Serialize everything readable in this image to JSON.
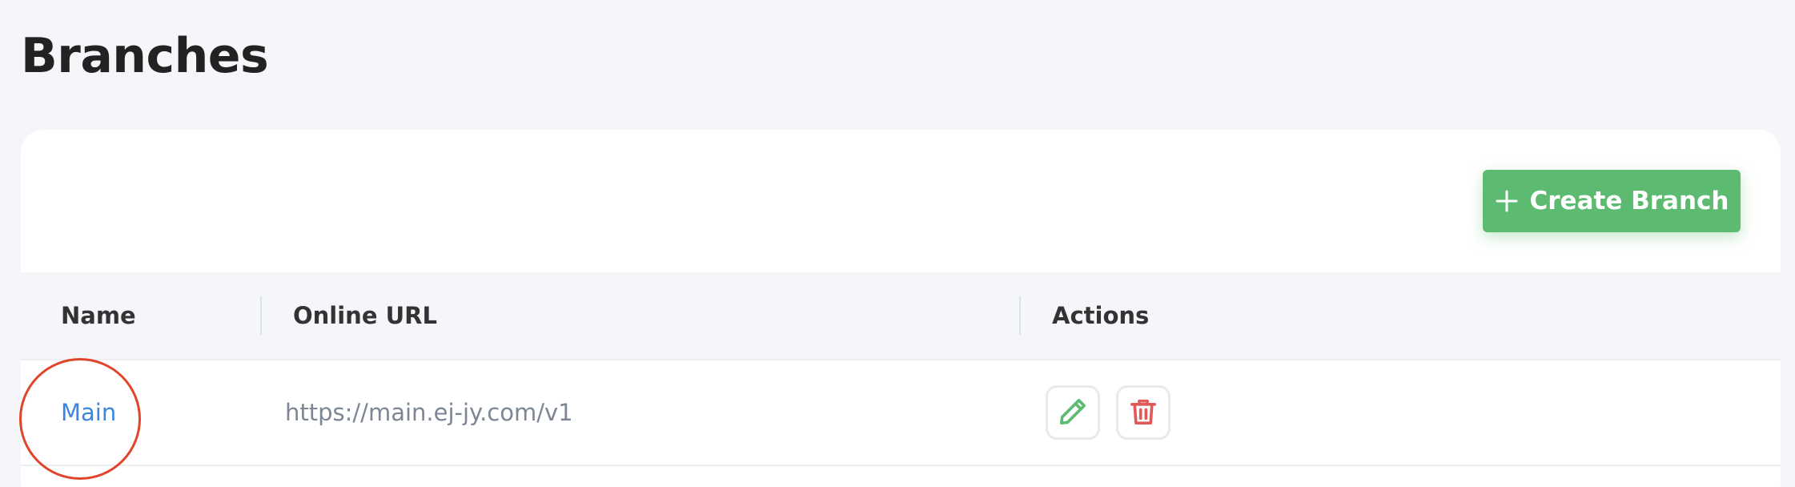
{
  "page": {
    "title": "Branches"
  },
  "toolbar": {
    "create_label": "Create Branch",
    "create_icon": "plus-icon"
  },
  "table": {
    "columns": [
      "Name",
      "Online URL",
      "Actions"
    ],
    "rows": [
      {
        "name": "Main",
        "online_url": "https://main.ej-jy.com/v1",
        "actions": [
          "pencil-icon",
          "trash-icon"
        ]
      }
    ]
  },
  "colors": {
    "primary_green": "#5dbb71",
    "link_blue": "#3b87e0",
    "danger_red": "#e05a5a",
    "annotation_red": "#e0452b"
  }
}
